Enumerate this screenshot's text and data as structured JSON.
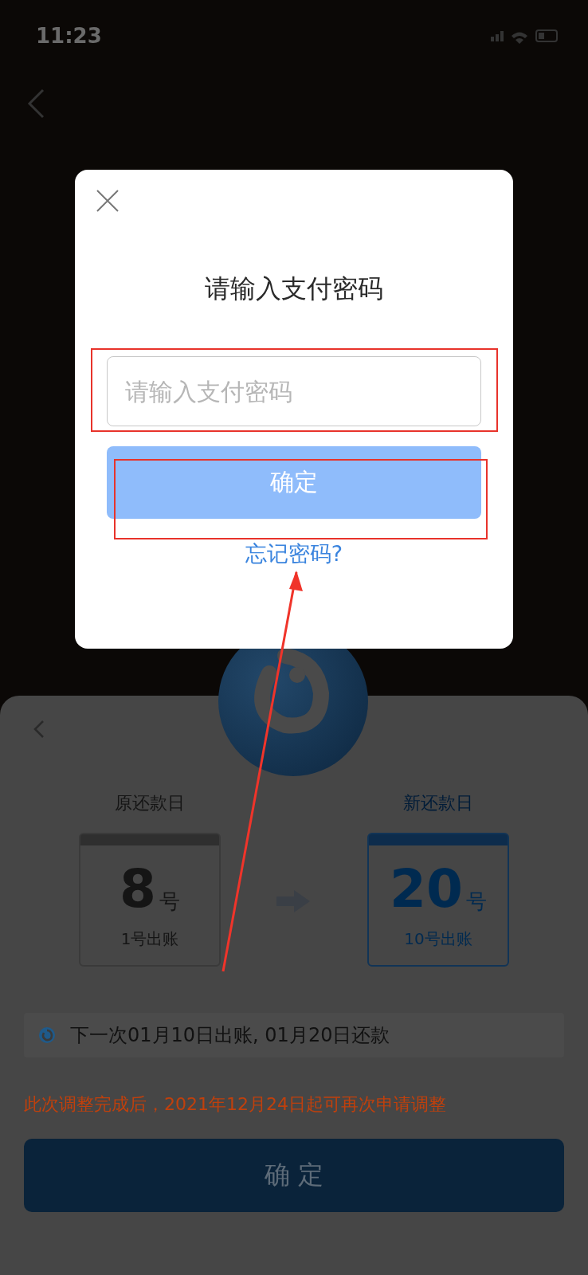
{
  "status_bar": {
    "time": "11:23"
  },
  "dialog": {
    "title": "请输入支付密码",
    "password_field": {
      "placeholder": "请输入支付密码"
    },
    "confirm_button": {
      "label": "确定",
      "disabled": true
    },
    "forgot_link": "忘记密码?"
  },
  "sheet": {
    "old_day": {
      "label": "原还款日",
      "day": "8",
      "unit": "号",
      "billing": "1号出账",
      "selected": false
    },
    "new_day": {
      "label": "新还款日",
      "day": "20",
      "unit": "号",
      "billing": "10号出账",
      "selected": true
    },
    "next_bill": "下一次01月10日出账, 01月20日还款",
    "notice": "此次调整完成后，2021年12月24日起可再次申请调整",
    "confirm_button": "确 定"
  },
  "annotations": [
    {
      "kind": "box"
    },
    {
      "kind": "box"
    },
    {
      "kind": "arrow"
    }
  ]
}
